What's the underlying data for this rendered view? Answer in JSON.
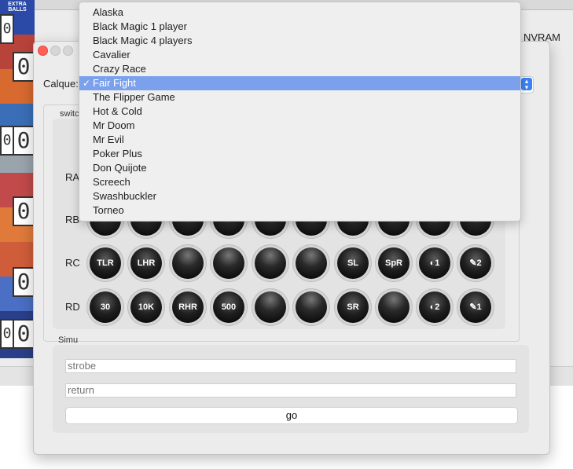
{
  "background_window": {
    "nvram_label": "NVRAM",
    "art_label": "EXTRA BALLS",
    "art_digits": [
      "0",
      "0",
      "0",
      "0",
      "0",
      "0",
      "0",
      "0"
    ]
  },
  "main_window": {
    "calque_label": "Calque:",
    "selected_layer": "Fair Fight",
    "switch_group_title": "switc",
    "rows": [
      {
        "label": "RA",
        "buttons": [
          "",
          "",
          "",
          "",
          "",
          "",
          "",
          "",
          "",
          ""
        ]
      },
      {
        "label": "RB",
        "buttons": [
          "",
          "",
          "",
          "",
          "",
          "",
          "",
          "",
          "",
          ""
        ]
      },
      {
        "label": "RC",
        "buttons": [
          "TLR",
          "LHR",
          "",
          "",
          "",
          "",
          "SL",
          "SpR",
          "◐1",
          "✎2"
        ]
      },
      {
        "label": "RD",
        "buttons": [
          "30",
          "10K",
          "RHR",
          "500",
          "",
          "",
          "SR",
          "",
          "◐2",
          "✎1"
        ]
      }
    ],
    "simu": {
      "title": "Simu",
      "strobe_placeholder": "strobe",
      "return_placeholder": "return",
      "go_label": "go"
    }
  },
  "dropdown": {
    "items": [
      "Alaska",
      "Black Magic 1 player",
      "Black Magic 4 players",
      "Cavalier",
      "Crazy Race",
      "Fair Fight",
      "The Flipper Game",
      "Hot & Cold",
      "Mr Doom",
      "Mr Evil",
      "Poker Plus",
      "Don Quijote",
      "Screech",
      "Swashbuckler",
      "Torneo"
    ],
    "selected_index": 5,
    "check_mark": "✓"
  },
  "colors": {
    "selection": "#7ba1ec",
    "accent": "#3b82f6",
    "close": "#ff5f57"
  }
}
